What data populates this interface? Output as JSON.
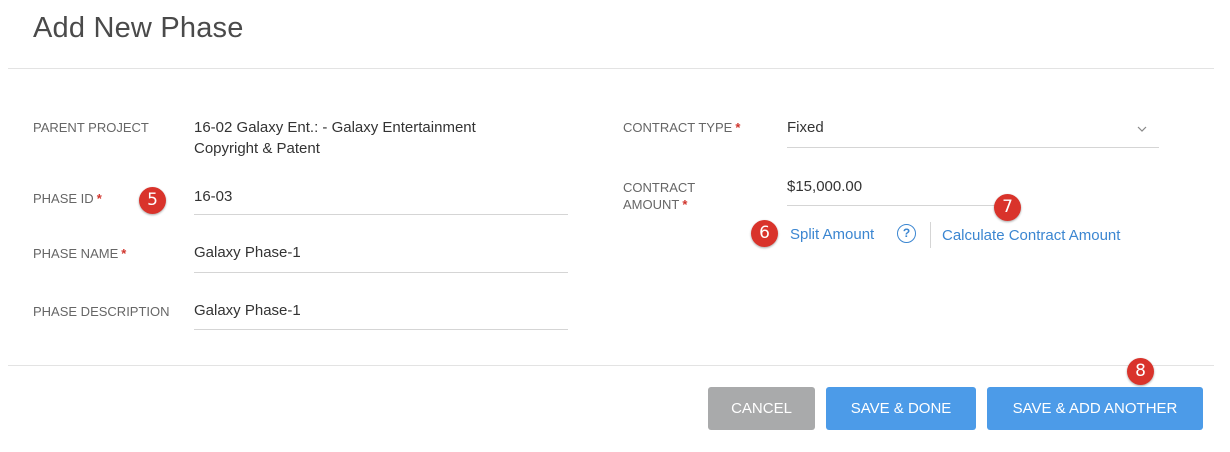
{
  "dialog": {
    "title": "Add New Phase"
  },
  "form": {
    "parent_project": {
      "label": "PARENT PROJECT",
      "value_line1": "16-02 Galaxy Ent.: - Galaxy Entertainment",
      "value_line2": "Copyright & Patent"
    },
    "phase_id": {
      "label": "PHASE ID",
      "value": "16-03"
    },
    "phase_name": {
      "label": "PHASE NAME",
      "value": "Galaxy Phase-1"
    },
    "phase_description": {
      "label": "PHASE DESCRIPTION",
      "value": "Galaxy Phase-1"
    },
    "contract_type": {
      "label": "CONTRACT TYPE",
      "value": "Fixed"
    },
    "contract_amount": {
      "label_line1": "CONTRACT",
      "label_line2": "AMOUNT",
      "value": "$15,000.00"
    },
    "required_mark": "*"
  },
  "links": {
    "split_amount": "Split Amount",
    "help": "?",
    "calculate": "Calculate Contract Amount"
  },
  "callouts": {
    "b5": "5",
    "b6": "6",
    "b7": "7",
    "b8": "8"
  },
  "buttons": {
    "cancel": "CANCEL",
    "save_done": "SAVE & DONE",
    "save_add_another": "SAVE & ADD ANOTHER"
  },
  "colors": {
    "accent": "#4c9be8",
    "link": "#3b86d1",
    "required": "#d0342c",
    "callout": "#d9332b",
    "cancel": "#a9aaab"
  },
  "icons": {
    "dropdown": "chevron-down-icon",
    "help": "question-circle-icon"
  }
}
